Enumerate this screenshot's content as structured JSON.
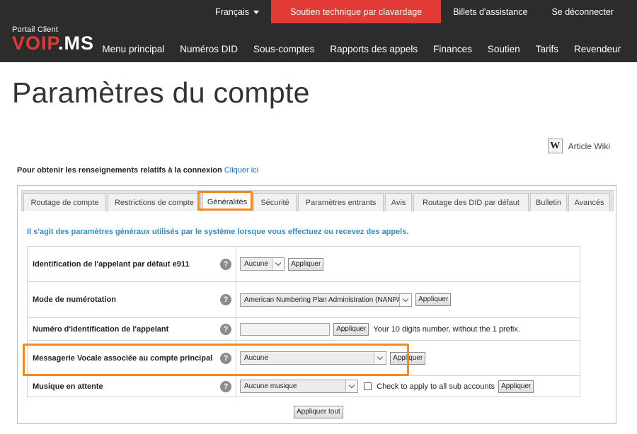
{
  "header": {
    "language_label": "Français",
    "support_chat_label": "Soutien technique par clavardage",
    "tickets_label": "Billets d'assistance",
    "logout_label": "Se déconnecter",
    "portal_label": "Portail Client",
    "logo_text_red": "VOIP",
    "logo_text_white": ".MS",
    "nav": [
      {
        "label": "Menu principal"
      },
      {
        "label": "Numéros DID"
      },
      {
        "label": "Sous-comptes"
      },
      {
        "label": "Rapports des appels"
      },
      {
        "label": "Finances"
      },
      {
        "label": "Soutien"
      },
      {
        "label": "Tarifs"
      },
      {
        "label": "Revendeur"
      }
    ],
    "colors": {
      "bar": "#2c2c2c",
      "support_button": "#e23a37",
      "highlight": "#f7871f",
      "intro_text": "#2d8fc7"
    }
  },
  "page": {
    "title": "Paramètres du compte",
    "wiki_icon": "W",
    "wiki_label": "Article Wiki",
    "login_info_text": "Pour obtenir les renseignements relatifs à la connexion",
    "login_info_link": "Cliquer ici"
  },
  "tabs": [
    {
      "label": "Routage de compte"
    },
    {
      "label": "Restrictions de compte"
    },
    {
      "label": "Généralités",
      "active": true
    },
    {
      "label": "Sécurité"
    },
    {
      "label": "Paramètres entrants"
    },
    {
      "label": "Avis"
    },
    {
      "label": "Routage des DID par défaut"
    },
    {
      "label": "Bulletin"
    },
    {
      "label": "Avancés"
    }
  ],
  "general": {
    "intro": "Il s'agit des paramètres généraux utilisés par le système lorsque vous effectuez ou recevez des appels.",
    "help_icon": "?",
    "apply_label": "Appliquer",
    "apply_all_label": "Appliquer tout",
    "rows": {
      "e911": {
        "label": "Identification de l'appelant par défaut e911",
        "select_value": "Aucune"
      },
      "dialing": {
        "label": "Mode de numérotation",
        "select_value": "American Numbering Plan Administration (NANPA)"
      },
      "callerid": {
        "label": "Numéro d'identification de l'appelant",
        "input_value": "",
        "hint": "Your 10 digits number, without the 1 prefix."
      },
      "voicemail": {
        "label": "Messagerie Vocale associée au compte principal",
        "select_value": "Aucune"
      },
      "moh": {
        "label": "Musique en attente",
        "select_value": "Aucune musique",
        "checkbox_label": "Check to apply to all sub accounts",
        "checked": false
      }
    }
  }
}
